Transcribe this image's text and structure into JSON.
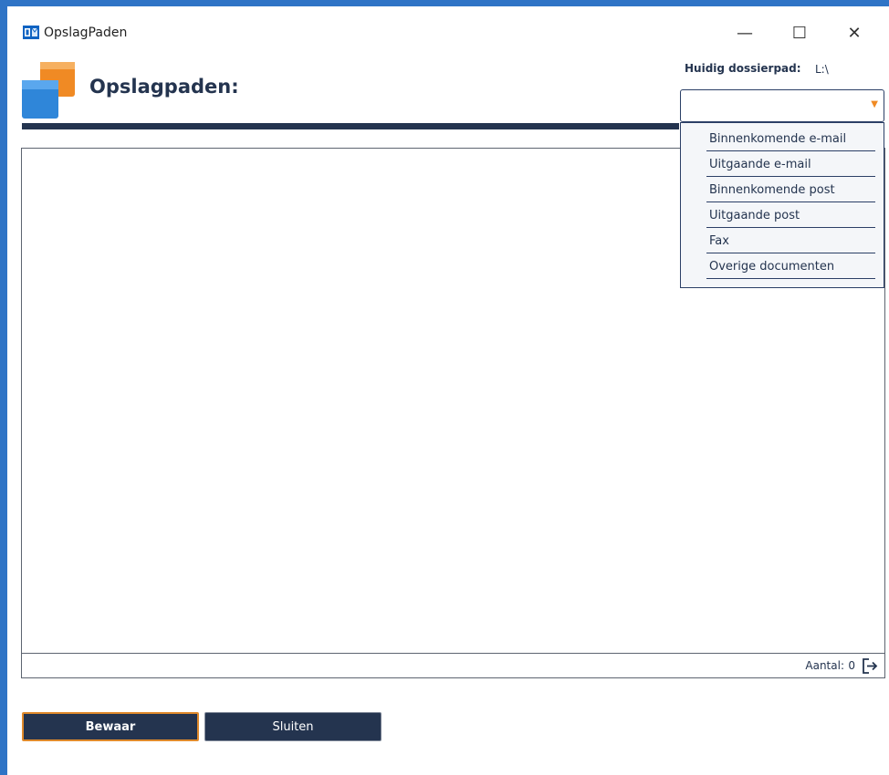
{
  "window": {
    "title": "OpslagPaden",
    "minimize_symbol": "—",
    "maximize_symbol": "☐",
    "close_symbol": "✕"
  },
  "header": {
    "title": "Opslagpaden:",
    "path_label": "Huidig dossierpad:",
    "path_value": "L:\\"
  },
  "dropdown": {
    "value": "",
    "arrow": "▼",
    "options": [
      "Binnenkomende e-mail",
      "Uitgaande e-mail",
      "Binnenkomende post",
      "Uitgaande post",
      "Fax",
      "Overige documenten"
    ]
  },
  "status": {
    "count_label": "Aantal:",
    "count_value": "0"
  },
  "buttons": {
    "save_label": "Bewaar",
    "close_label": "Sluiten"
  },
  "colors": {
    "accent": "#24344f",
    "frame": "#2f74c6",
    "highlight": "#e08a2c"
  },
  "icons": {
    "app": "outlook-icon",
    "logo": "folders-logo",
    "export": "export-icon"
  }
}
